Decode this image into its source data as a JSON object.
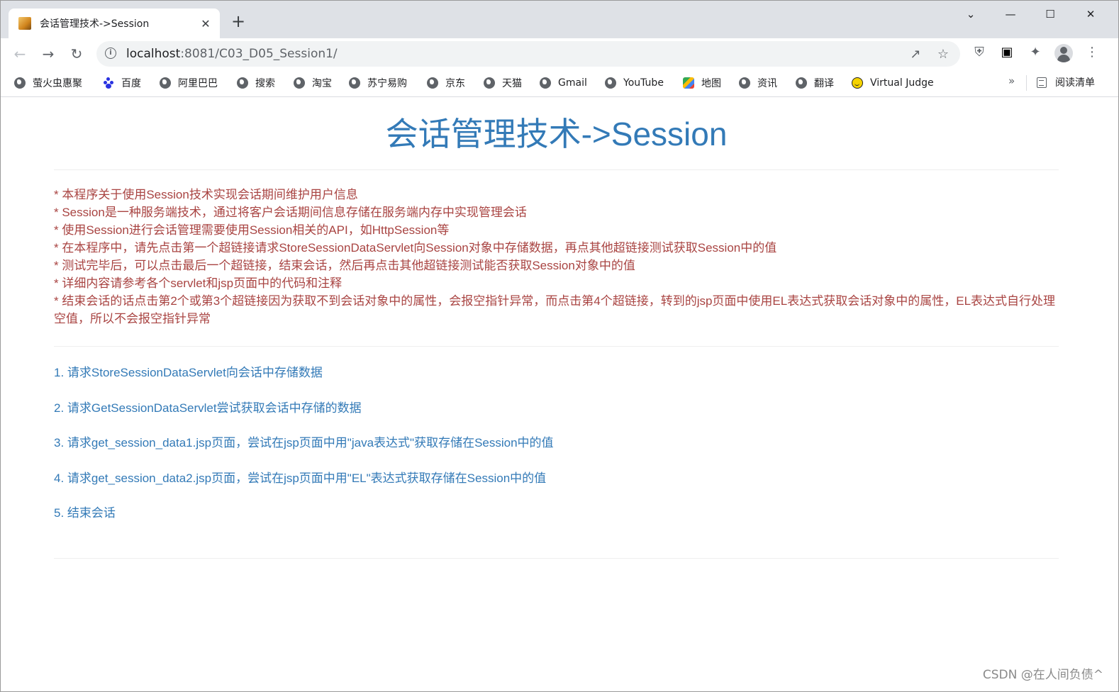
{
  "browser": {
    "tab_title": "会话管理技术->Session",
    "tab_close": "✕",
    "new_tab": "+",
    "window_controls": {
      "dropdown": "⌄",
      "minimize": "—",
      "maximize": "☐",
      "close": "✕"
    },
    "url_host": "localhost",
    "url_rest": ":8081/C03_D05_Session1/",
    "bookmarks": [
      {
        "label": "萤火虫惠聚",
        "icon": "globe-icon"
      },
      {
        "label": "百度",
        "icon": "baidu-icon"
      },
      {
        "label": "阿里巴巴",
        "icon": "globe-icon"
      },
      {
        "label": "搜索",
        "icon": "globe-icon"
      },
      {
        "label": "淘宝",
        "icon": "globe-icon"
      },
      {
        "label": "苏宁易购",
        "icon": "globe-icon"
      },
      {
        "label": "京东",
        "icon": "globe-icon"
      },
      {
        "label": "天猫",
        "icon": "globe-icon"
      },
      {
        "label": "Gmail",
        "icon": "globe-icon"
      },
      {
        "label": "YouTube",
        "icon": "globe-icon"
      },
      {
        "label": "地图",
        "icon": "maps-icon"
      },
      {
        "label": "资讯",
        "icon": "globe-icon"
      },
      {
        "label": "翻译",
        "icon": "globe-icon"
      },
      {
        "label": "Virtual Judge",
        "icon": "virtual-judge-icon"
      }
    ],
    "bookmarks_more": "»",
    "reading_list": "阅读清单"
  },
  "page": {
    "title": "会话管理技术->Session",
    "notes": [
      "* 本程序关于使用Session技术实现会话期间维护用户信息",
      "* Session是一种服务端技术，通过将客户会话期间信息存储在服务端内存中实现管理会话",
      "* 使用Session进行会话管理需要使用Session相关的API，如HttpSession等",
      "* 在本程序中，请先点击第一个超链接请求StoreSessionDataServlet向Session对象中存储数据，再点其他超链接测试获取Session中的值",
      "* 测试完毕后，可以点击最后一个超链接，结束会话，然后再点击其他超链接测试能否获取Session对象中的值",
      "* 详细内容请参考各个servlet和jsp页面中的代码和注释",
      "* 结束会话的话点击第2个或第3个超链接因为获取不到会话对象中的属性，会报空指针异常，而点击第4个超链接，转到的jsp页面中使用EL表达式获取会话对象中的属性，EL表达式自行处理空值，所以不会报空指针异常"
    ],
    "links": [
      "1. 请求StoreSessionDataServlet向会话中存储数据",
      "2. 请求GetSessionDataServlet尝试获取会话中存储的数据",
      "3. 请求get_session_data1.jsp页面，尝试在jsp页面中用\"java表达式\"获取存储在Session中的值",
      "4. 请求get_session_data2.jsp页面，尝试在jsp页面中用\"EL\"表达式获取存储在Session中的值",
      "5. 结束会话"
    ]
  },
  "watermark": "CSDN @在人间负债^",
  "colors": {
    "title": "#337ab7",
    "notes": "#a94442",
    "links": "#337ab7"
  }
}
